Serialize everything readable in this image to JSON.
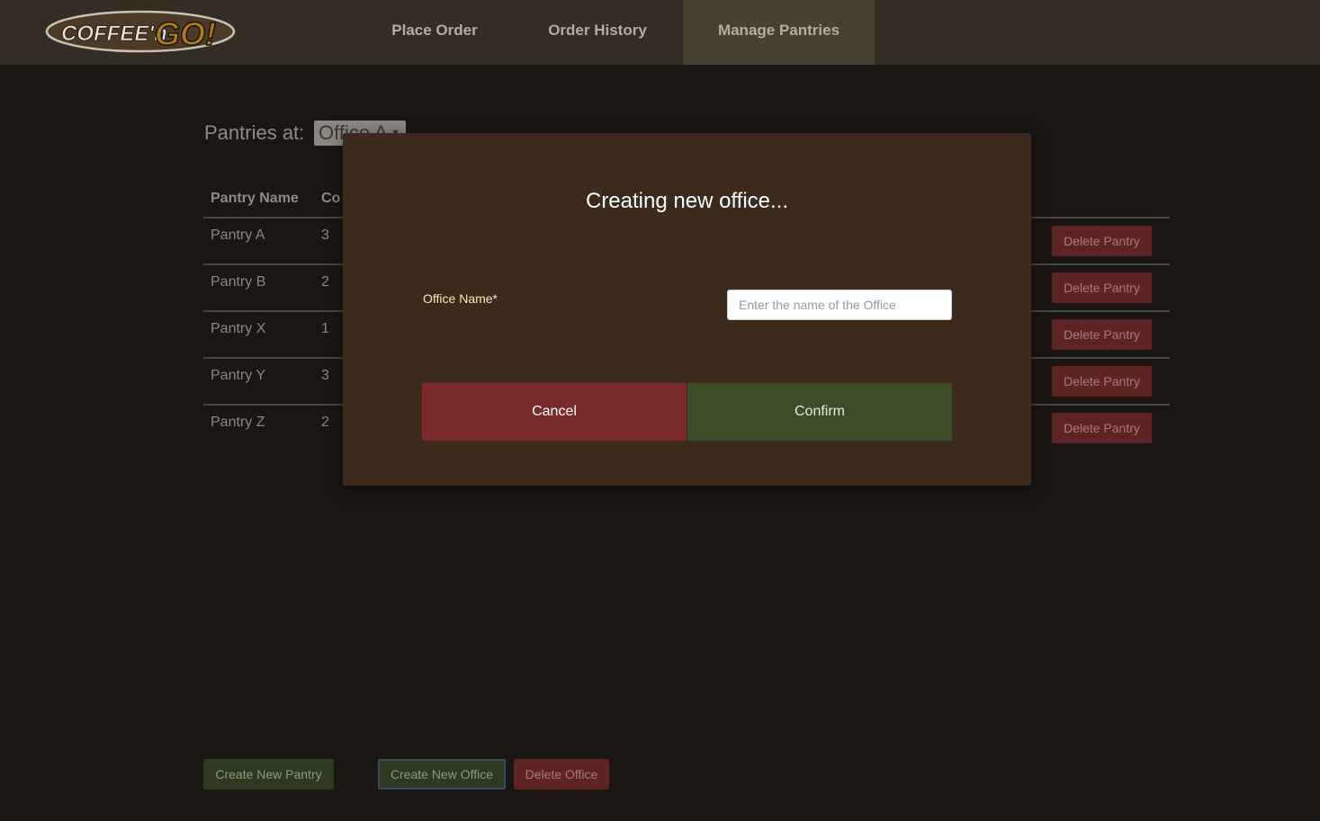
{
  "header": {
    "logo_text": "COFFEE'n GO!",
    "nav": [
      {
        "label": "Place Order"
      },
      {
        "label": "Order History"
      },
      {
        "label": "Manage Pantries"
      }
    ],
    "active_tab": "Manage Pantries"
  },
  "pantries_view": {
    "label": "Pantries at:",
    "selected_office": "Office A",
    "columns": [
      "Pantry Name",
      "Co"
    ],
    "rows": [
      {
        "name": "Pantry A",
        "count": "3",
        "action": "Delete Pantry"
      },
      {
        "name": "Pantry B",
        "count": "2",
        "action": "Delete Pantry"
      },
      {
        "name": "Pantry X",
        "count": "1",
        "action": "Delete Pantry"
      },
      {
        "name": "Pantry Y",
        "count": "3",
        "action": "Delete Pantry"
      },
      {
        "name": "Pantry Z",
        "count": "2",
        "action": "Delete Pantry"
      }
    ]
  },
  "footer_actions": {
    "create_pantry": "Create New Pantry",
    "create_office": "Create New Office",
    "delete_office": "Delete Office"
  },
  "modal": {
    "title": "Creating new office...",
    "field_label": "Office Name*",
    "input_placeholder": "Enter the name of the Office",
    "input_value": "",
    "cancel_label": "Cancel",
    "confirm_label": "Confirm"
  },
  "colors": {
    "background": "#1a1713",
    "navbar": "#332d23",
    "modal": "#3c2b1c",
    "cancel": "#7a2a2a",
    "confirm": "#3b4e29",
    "label_accent": "#f5e7b8"
  }
}
